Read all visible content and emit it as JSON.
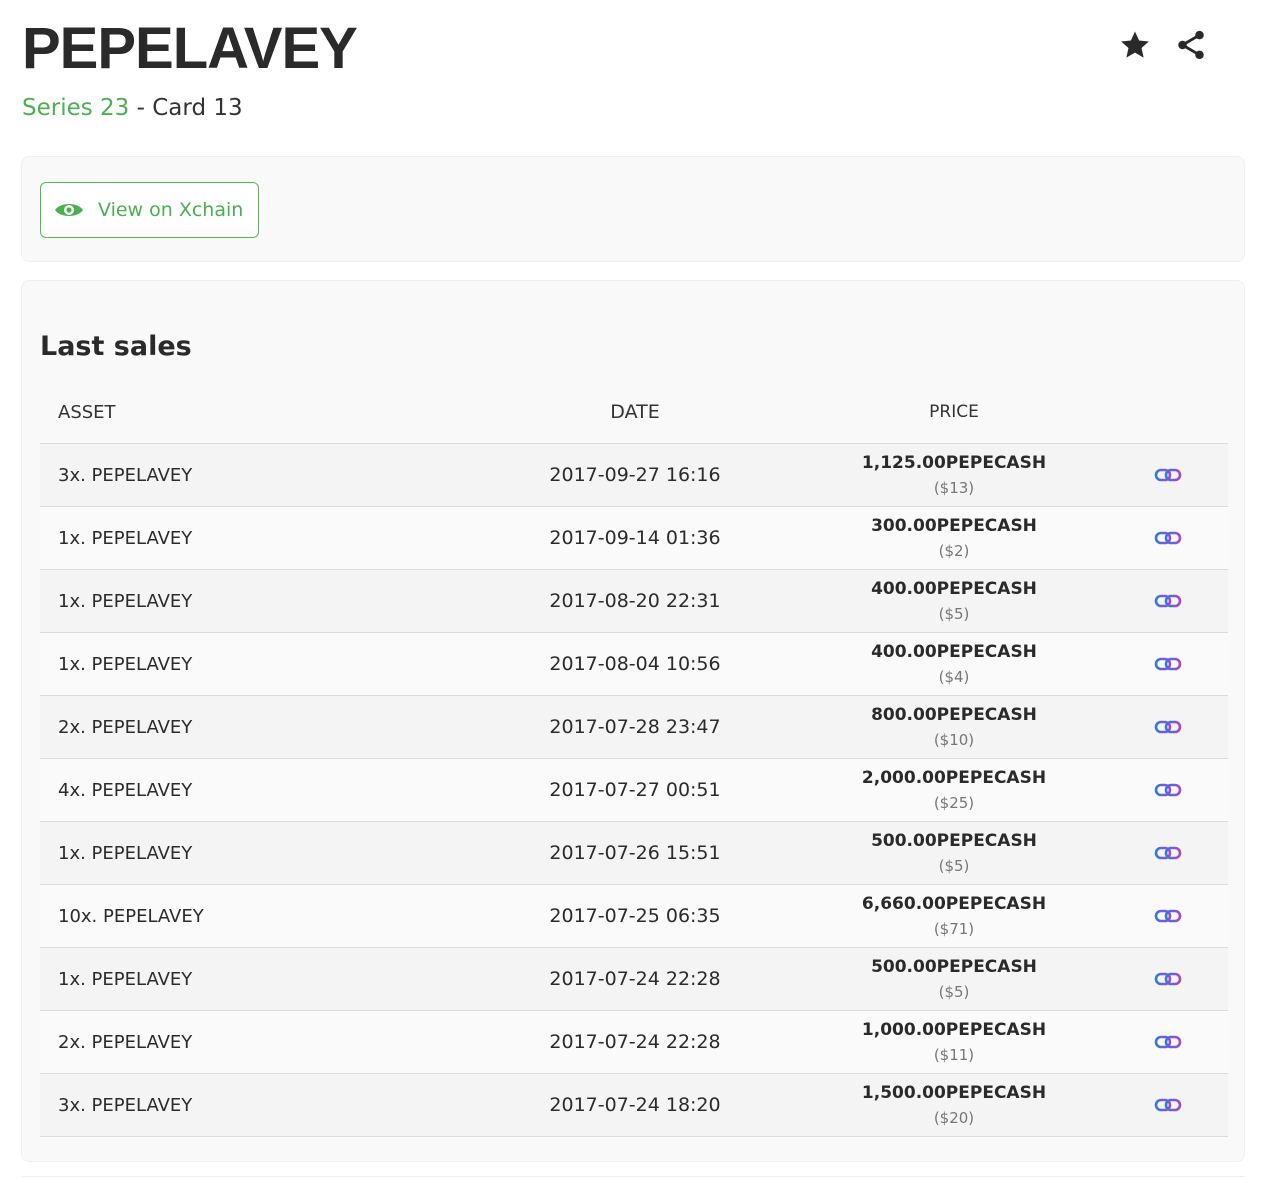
{
  "header": {
    "title": "PEPELAVEY",
    "series_label": "Series 23",
    "card_label": " - Card 13",
    "favorite_icon": "star-icon",
    "share_icon": "share-icon"
  },
  "xchain": {
    "label": "View on Xchain",
    "icon": "eye-icon",
    "color": "#4caf50"
  },
  "sales": {
    "title": "Last sales",
    "columns": {
      "asset": "ASSET",
      "date": "DATE",
      "price": "PRICE"
    },
    "rows": [
      {
        "asset": "3x. PEPELAVEY",
        "date": "2017-09-27 16:16",
        "price": "1,125.00PEPECASH",
        "usd": "($13)"
      },
      {
        "asset": "1x. PEPELAVEY",
        "date": "2017-09-14 01:36",
        "price": "300.00PEPECASH",
        "usd": "($2)"
      },
      {
        "asset": "1x. PEPELAVEY",
        "date": "2017-08-20 22:31",
        "price": "400.00PEPECASH",
        "usd": "($5)"
      },
      {
        "asset": "1x. PEPELAVEY",
        "date": "2017-08-04 10:56",
        "price": "400.00PEPECASH",
        "usd": "($4)"
      },
      {
        "asset": "2x. PEPELAVEY",
        "date": "2017-07-28 23:47",
        "price": "800.00PEPECASH",
        "usd": "($10)"
      },
      {
        "asset": "4x. PEPELAVEY",
        "date": "2017-07-27 00:51",
        "price": "2,000.00PEPECASH",
        "usd": "($25)"
      },
      {
        "asset": "1x. PEPELAVEY",
        "date": "2017-07-26 15:51",
        "price": "500.00PEPECASH",
        "usd": "($5)"
      },
      {
        "asset": "10x. PEPELAVEY",
        "date": "2017-07-25 06:35",
        "price": "6,660.00PEPECASH",
        "usd": "($71)"
      },
      {
        "asset": "1x. PEPELAVEY",
        "date": "2017-07-24 22:28",
        "price": "500.00PEPECASH",
        "usd": "($5)"
      },
      {
        "asset": "2x. PEPELAVEY",
        "date": "2017-07-24 22:28",
        "price": "1,000.00PEPECASH",
        "usd": "($11)"
      },
      {
        "asset": "3x. PEPELAVEY",
        "date": "2017-07-24 18:20",
        "price": "1,500.00PEPECASH",
        "usd": "($20)"
      }
    ],
    "row_link_icon": "chain-link-icon"
  }
}
